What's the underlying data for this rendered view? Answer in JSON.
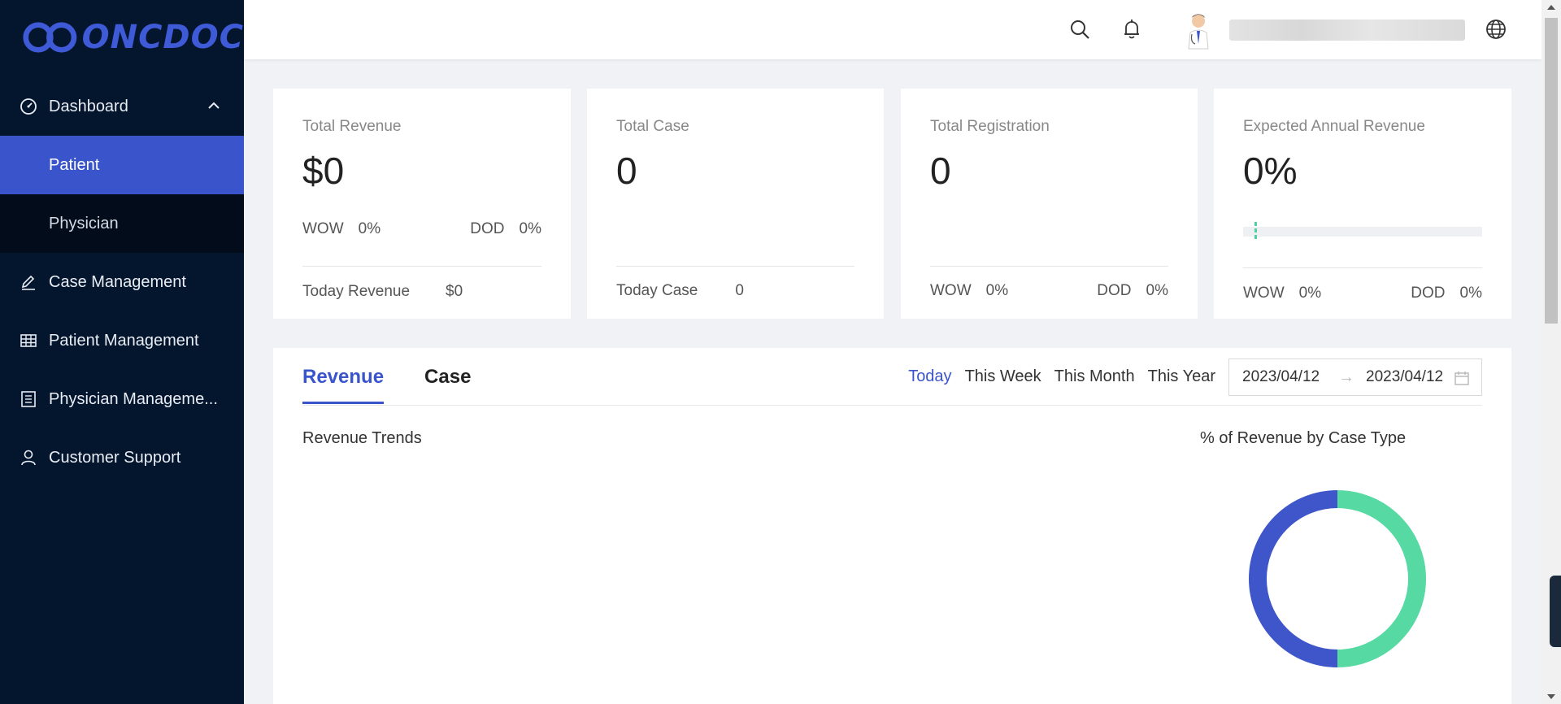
{
  "brand": {
    "name": "ONCDOC",
    "color": "#3e5ad6"
  },
  "sidebar": {
    "dashboard": {
      "label": "Dashboard",
      "icon": "dashboard-icon",
      "expanded": true
    },
    "sub_items": [
      {
        "label": "Patient",
        "active": true
      },
      {
        "label": "Physician",
        "active": false
      }
    ],
    "items": [
      {
        "label": "Case Management",
        "icon": "edit-icon"
      },
      {
        "label": "Patient Management",
        "icon": "table-icon"
      },
      {
        "label": "Physician Manageme...",
        "icon": "list-icon"
      },
      {
        "label": "Customer Support",
        "icon": "user-icon"
      }
    ]
  },
  "header": {
    "icons": [
      "search-icon",
      "bell-icon",
      "globe-icon"
    ]
  },
  "cards": {
    "revenue": {
      "label": "Total Revenue",
      "value": "$0",
      "wow_label": "WOW",
      "wow_value": "0%",
      "dod_label": "DOD",
      "dod_value": "0%",
      "today_label": "Today Revenue",
      "today_value": "$0"
    },
    "case": {
      "label": "Total Case",
      "value": "0",
      "today_label": "Today Case",
      "today_value": "0"
    },
    "registration": {
      "label": "Total Registration",
      "value": "0",
      "wow_label": "WOW",
      "wow_value": "0%",
      "dod_label": "DOD",
      "dod_value": "0%"
    },
    "expected": {
      "label": "Expected Annual Revenue",
      "value": "0%",
      "progress": 0,
      "wow_label": "WOW",
      "wow_value": "0%",
      "dod_label": "DOD",
      "dod_value": "0%"
    }
  },
  "panel": {
    "tabs": [
      {
        "label": "Revenue",
        "active": true
      },
      {
        "label": "Case",
        "active": false
      }
    ],
    "periods": [
      {
        "label": "Today",
        "active": true
      },
      {
        "label": "This Week",
        "active": false
      },
      {
        "label": "This Month",
        "active": false
      },
      {
        "label": "This Year",
        "active": false
      }
    ],
    "date_start": "2023/04/12",
    "date_end": "2023/04/12",
    "trend_title": "Revenue Trends",
    "pie_title": "% of Revenue by Case Type"
  },
  "chart_data": {
    "type": "pie",
    "title": "% of Revenue by Case Type",
    "values": [
      50,
      50
    ],
    "colors": [
      "#57d9a3",
      "#3e56c9"
    ],
    "donut": true
  }
}
